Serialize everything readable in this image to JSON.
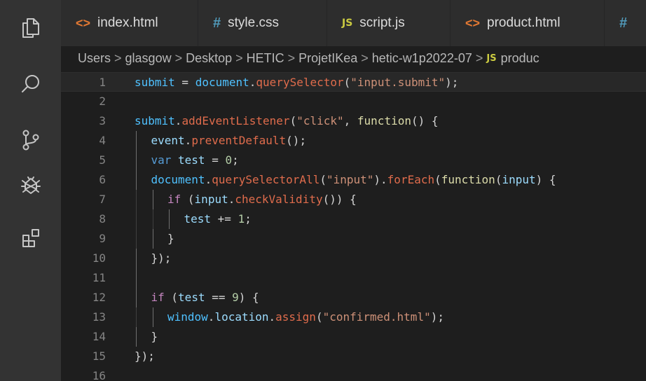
{
  "tabs": [
    {
      "label": "index.html",
      "icon": "<>",
      "kind": "html"
    },
    {
      "label": "style.css",
      "icon": "#",
      "kind": "css"
    },
    {
      "label": "script.js",
      "icon": "JS",
      "kind": "js"
    },
    {
      "label": "product.html",
      "icon": "<>",
      "kind": "html"
    },
    {
      "label": "",
      "icon": "#",
      "kind": "css"
    }
  ],
  "breadcrumb": {
    "items": [
      "Users",
      "glasgow",
      "Desktop",
      "HETIC",
      "ProjetIKea",
      "hetic-w1p2022-07"
    ],
    "file_icon": "JS",
    "file": "produc",
    "separator": ">"
  },
  "activity_icons": [
    "files-icon",
    "search-icon",
    "source-control-icon",
    "debug-icon",
    "extensions-icon"
  ],
  "editor": {
    "current_line": 1,
    "lines": [
      {
        "n": "1",
        "indent": 0,
        "tokens": [
          [
            "submit",
            "var"
          ],
          [
            " = ",
            "op"
          ],
          [
            "document",
            "var"
          ],
          [
            ".",
            "punc"
          ],
          [
            "querySelector",
            "method"
          ],
          [
            "(",
            "punc"
          ],
          [
            "\"input.submit\"",
            "str"
          ],
          [
            ");",
            "punc"
          ]
        ]
      },
      {
        "n": "2",
        "indent": 0,
        "tokens": []
      },
      {
        "n": "3",
        "indent": 0,
        "tokens": [
          [
            "submit",
            "var"
          ],
          [
            ".",
            "punc"
          ],
          [
            "addEventListener",
            "method"
          ],
          [
            "(",
            "punc"
          ],
          [
            "\"click\"",
            "str"
          ],
          [
            ", ",
            "punc"
          ],
          [
            "function",
            "fn"
          ],
          [
            "() {",
            "punc"
          ]
        ]
      },
      {
        "n": "4",
        "indent": 1,
        "tokens": [
          [
            "event",
            "id"
          ],
          [
            ".",
            "punc"
          ],
          [
            "preventDefault",
            "method"
          ],
          [
            "();",
            "punc"
          ]
        ]
      },
      {
        "n": "5",
        "indent": 1,
        "tokens": [
          [
            "var ",
            "kw"
          ],
          [
            "test",
            "id"
          ],
          [
            " = ",
            "op"
          ],
          [
            "0",
            "num"
          ],
          [
            ";",
            "punc"
          ]
        ]
      },
      {
        "n": "6",
        "indent": 1,
        "tokens": [
          [
            "document",
            "var"
          ],
          [
            ".",
            "punc"
          ],
          [
            "querySelectorAll",
            "method"
          ],
          [
            "(",
            "punc"
          ],
          [
            "\"input\"",
            "str"
          ],
          [
            ").",
            "punc"
          ],
          [
            "forEach",
            "method"
          ],
          [
            "(",
            "punc"
          ],
          [
            "function",
            "fn"
          ],
          [
            "(",
            "punc"
          ],
          [
            "input",
            "id"
          ],
          [
            ") {",
            "punc"
          ]
        ]
      },
      {
        "n": "7",
        "indent": 2,
        "tokens": [
          [
            "if ",
            "ctrl"
          ],
          [
            "(",
            "punc"
          ],
          [
            "input",
            "id"
          ],
          [
            ".",
            "punc"
          ],
          [
            "checkValidity",
            "method"
          ],
          [
            "()) {",
            "punc"
          ]
        ]
      },
      {
        "n": "8",
        "indent": 3,
        "tokens": [
          [
            "test",
            "id"
          ],
          [
            " += ",
            "op"
          ],
          [
            "1",
            "num"
          ],
          [
            ";",
            "punc"
          ]
        ]
      },
      {
        "n": "9",
        "indent": 2,
        "tokens": [
          [
            "}",
            "punc"
          ]
        ]
      },
      {
        "n": "10",
        "indent": 1,
        "tokens": [
          [
            "});",
            "punc"
          ]
        ]
      },
      {
        "n": "11",
        "indent": 1,
        "tokens": []
      },
      {
        "n": "12",
        "indent": 1,
        "tokens": [
          [
            "if ",
            "ctrl"
          ],
          [
            "(",
            "punc"
          ],
          [
            "test",
            "id"
          ],
          [
            " == ",
            "op"
          ],
          [
            "9",
            "num"
          ],
          [
            ") {",
            "punc"
          ]
        ]
      },
      {
        "n": "13",
        "indent": 2,
        "tokens": [
          [
            "window",
            "var"
          ],
          [
            ".",
            "punc"
          ],
          [
            "location",
            "id"
          ],
          [
            ".",
            "punc"
          ],
          [
            "assign",
            "method"
          ],
          [
            "(",
            "punc"
          ],
          [
            "\"confirmed.html\"",
            "str"
          ],
          [
            ");",
            "punc"
          ]
        ]
      },
      {
        "n": "14",
        "indent": 1,
        "tokens": [
          [
            "}",
            "punc"
          ]
        ]
      },
      {
        "n": "15",
        "indent": 0,
        "tokens": [
          [
            "});",
            "punc"
          ]
        ]
      },
      {
        "n": "16",
        "indent": 0,
        "tokens": []
      }
    ]
  }
}
